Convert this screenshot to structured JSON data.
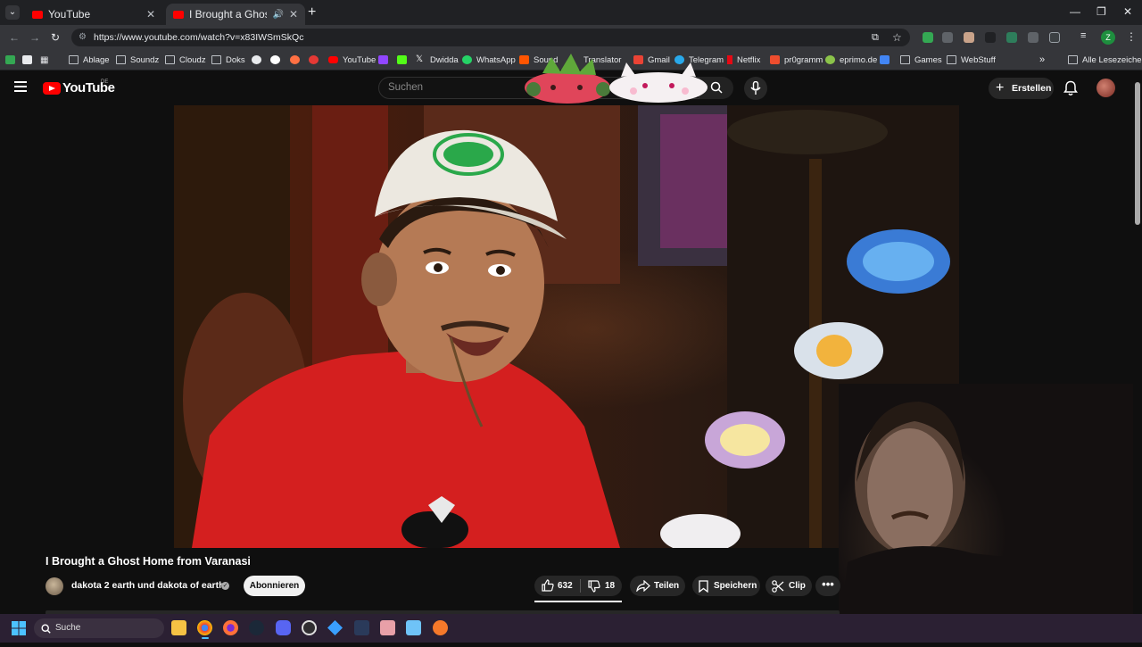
{
  "browser": {
    "tabs": [
      {
        "title": "YouTube",
        "favicon": "youtube-icon"
      },
      {
        "title": "I Brought a Ghost Home fro",
        "favicon": "youtube-icon",
        "active": true,
        "audio": "speaker-icon"
      }
    ],
    "new_tab": "+",
    "window_controls": {
      "minimize": "—",
      "restore": "❐",
      "close": "✕"
    },
    "url": "https://www.youtube.com/watch?v=x83IWSmSkQc",
    "profile_initial": "Z",
    "bookmarks": [
      {
        "label": "Ablage",
        "icon": "folder-icon"
      },
      {
        "label": "Soundz",
        "icon": "folder-icon"
      },
      {
        "label": "Cloudz",
        "icon": "folder-icon"
      },
      {
        "label": "Doks",
        "icon": "folder-icon"
      },
      {
        "label": "YouTube",
        "icon": "youtube-icon"
      },
      {
        "label": "Dwidda",
        "icon": "x-icon"
      },
      {
        "label": "WhatsApp",
        "icon": "whatsapp-icon"
      },
      {
        "label": "Sound",
        "icon": "soundcloud-icon"
      },
      {
        "label": "Translator",
        "icon": "translate-icon"
      },
      {
        "label": "Gmail",
        "icon": "gmail-icon"
      },
      {
        "label": "Telegram",
        "icon": "telegram-icon"
      },
      {
        "label": "Netflix",
        "icon": "netflix-icon"
      },
      {
        "label": "pr0gramm",
        "icon": "pr0gramm-icon"
      },
      {
        "label": "eprimo.de",
        "icon": "eprimo-icon"
      },
      {
        "label": "Games",
        "icon": "folder-icon"
      },
      {
        "label": "WebStuff",
        "icon": "folder-icon"
      }
    ],
    "bookmarks_overflow": "»",
    "all_bookmarks": "Alle Lesezeichen"
  },
  "youtube": {
    "logo_text": "YouTube",
    "region": "DE",
    "search_placeholder": "Suchen",
    "create_label": "Erstellen",
    "video": {
      "title": "I Brought a Ghost Home from Varanasi",
      "channel": "dakota 2 earth und dakota of earth",
      "subscribe_label": "Abonnieren",
      "likes": "632",
      "dislikes": "18",
      "share_label": "Teilen",
      "save_label": "Speichern",
      "clip_label": "Clip",
      "more_label": "•••"
    }
  },
  "taskbar": {
    "search_label": "Suche",
    "apps": [
      "file-explorer-icon",
      "chrome-icon",
      "firefox-icon",
      "steam-icon",
      "discord-icon",
      "obs-icon",
      "app-icon",
      "audio-editor-icon",
      "photos-icon",
      "notepad-icon",
      "blender-icon"
    ]
  },
  "colors": {
    "yt_red": "#ff0000",
    "background": "#0f0f0f",
    "pill": "#272727",
    "taskbar": "#2b2033"
  }
}
